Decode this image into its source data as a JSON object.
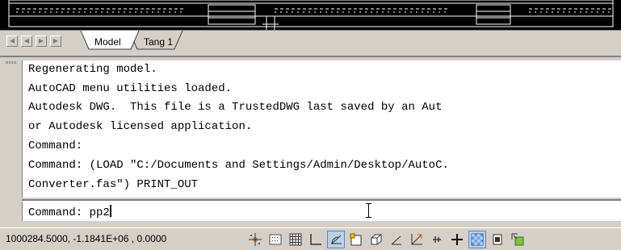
{
  "layout_tabs": {
    "items": [
      {
        "label": "Model",
        "active": true
      },
      {
        "label": "Tang 1",
        "active": false
      }
    ]
  },
  "command_history": [
    "Regenerating model.",
    "AutoCAD menu utilities loaded.",
    "Autodesk DWG.  This file is a TrustedDWG last saved by an Aut",
    "or Autodesk licensed application.",
    "Command:",
    "Command: (LOAD \"C:/Documents and Settings/Admin/Desktop/AutoC.",
    "Converter.fas\") PRINT_OUT"
  ],
  "command_line": {
    "prompt": "Command: ",
    "value": "pp2"
  },
  "status_bar": {
    "coordinates": "1000284.5000, -1.1841E+06 , 0.0000",
    "toggles": [
      {
        "name": "snap-icon",
        "on": false
      },
      {
        "name": "grid-icon",
        "on": false
      },
      {
        "name": "ortho-icon",
        "on": false
      },
      {
        "name": "polar-icon",
        "on": false
      },
      {
        "name": "osnap-icon",
        "on": true
      },
      {
        "name": "3d-osnap-icon",
        "on": false
      },
      {
        "name": "otrack-icon",
        "on": false
      },
      {
        "name": "ducs-icon",
        "on": false
      },
      {
        "name": "dyn-icon",
        "on": false
      },
      {
        "name": "lineweight-icon",
        "on": false
      },
      {
        "name": "crosshair-icon",
        "on": false
      },
      {
        "name": "transparency-icon",
        "on": true
      },
      {
        "name": "quick-properties-icon",
        "on": false
      },
      {
        "name": "selection-cycling-icon",
        "on": false
      }
    ]
  },
  "colors": {
    "drawing_background": "#000000",
    "drawing_lines": "#ffffff",
    "window_face": "#d4d0c8",
    "command_text": "#000000",
    "toggle_on": "#b9d1ea"
  }
}
